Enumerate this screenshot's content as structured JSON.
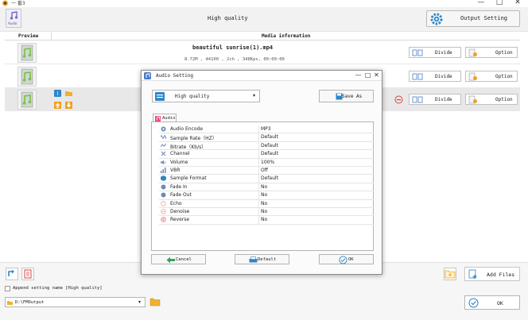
{
  "window": {
    "title": "一 番3",
    "controls": [
      "—",
      "□",
      "✕"
    ]
  },
  "toolbar": {
    "audio_tool_label": "Audio",
    "quality_header": "High quality",
    "output_setting_label": "Output Setting"
  },
  "list": {
    "columns": {
      "preview": "Preview",
      "media_info": "Media information"
    },
    "rows": [
      {
        "file_name": "beautiful sunrise(1).mp4",
        "meta": "8.72M , 44100 , 2ch , 348Kps, 00:00:00",
        "divide": "Divide",
        "option": "Option"
      },
      {
        "file_name": "",
        "meta": "",
        "divide": "Divide",
        "option": "Option"
      },
      {
        "file_name": "",
        "meta": "",
        "divide": "Divide",
        "option": "Option"
      }
    ]
  },
  "bottom": {
    "append_label": "Append setting name [High quality]",
    "output_path": "D:\\FMOutput",
    "add_files_label": "Add Files",
    "ok_label": "OK"
  },
  "dialog": {
    "title": "Audio Setting",
    "preset": "High quality",
    "save_as": "Save As",
    "tab_label": "Audio",
    "params": [
      {
        "name": "Audio Encode",
        "value": "MP3",
        "icon": "gear-icon"
      },
      {
        "name": "Sample Rate（HZ）",
        "value": "Default",
        "icon": "wave-icon"
      },
      {
        "name": "Bitrate（Kb/s）",
        "value": "Default",
        "icon": "bitrate-icon"
      },
      {
        "name": "Channel",
        "value": "Default",
        "icon": "channel-icon"
      },
      {
        "name": "Volume",
        "value": "100%",
        "icon": "speaker-icon"
      },
      {
        "name": "VBR",
        "value": "Off",
        "icon": "vbr-icon"
      },
      {
        "name": "Sample Format",
        "value": "Default",
        "icon": "cube-icon"
      },
      {
        "name": "Fade In",
        "value": "No",
        "icon": "fade-in-icon"
      },
      {
        "name": "Fade Out",
        "value": "No",
        "icon": "fade-out-icon"
      },
      {
        "name": "Echo",
        "value": "No",
        "icon": "echo-icon"
      },
      {
        "name": "Denoise",
        "value": "No",
        "icon": "denoise-icon"
      },
      {
        "name": "Reverse",
        "value": "No",
        "icon": "reverse-icon"
      }
    ],
    "cancel": "Cancel",
    "default": "Default",
    "ok": "OK"
  },
  "colors": {
    "accent_blue": "#2e86c9",
    "icon_green": "#7cc04a",
    "icon_red": "#e04040",
    "icon_orange": "#f0a020"
  }
}
